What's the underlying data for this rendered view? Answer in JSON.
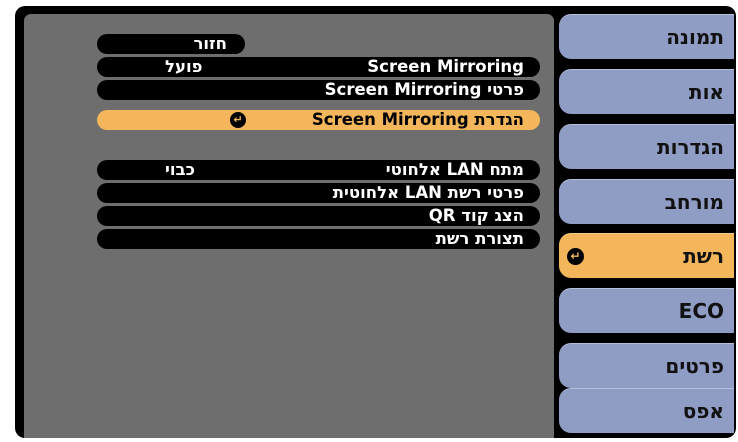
{
  "menu": {
    "rows": [
      {
        "label": "חזור",
        "value": ""
      },
      {
        "label": "Screen Mirroring",
        "value": "פועל"
      },
      {
        "label": "פרטי Screen Mirroring",
        "value": ""
      },
      {
        "label": "הגדרת Screen Mirroring",
        "value": "",
        "selected": true
      },
      {
        "label": "מתח LAN אלחוטי",
        "value": "כבוי"
      },
      {
        "label": "פרטי רשת LAN אלחוטית",
        "value": ""
      },
      {
        "label": "הצג קוד QR",
        "value": ""
      },
      {
        "label": "תצורת רשת",
        "value": ""
      }
    ]
  },
  "tabs": [
    {
      "label": "תמונה"
    },
    {
      "label": "אות"
    },
    {
      "label": "הגדרות"
    },
    {
      "label": "מורחב"
    },
    {
      "label": "רשת",
      "active": true
    },
    {
      "label": "ECO"
    },
    {
      "label": "פרטים"
    },
    {
      "label": "אפס"
    }
  ],
  "icons": {
    "enter": "enter-icon"
  },
  "colors": {
    "panel": "#6e6e6e",
    "tab": "#8f9cc4",
    "highlight": "#f3b65b",
    "row": "#000000"
  }
}
